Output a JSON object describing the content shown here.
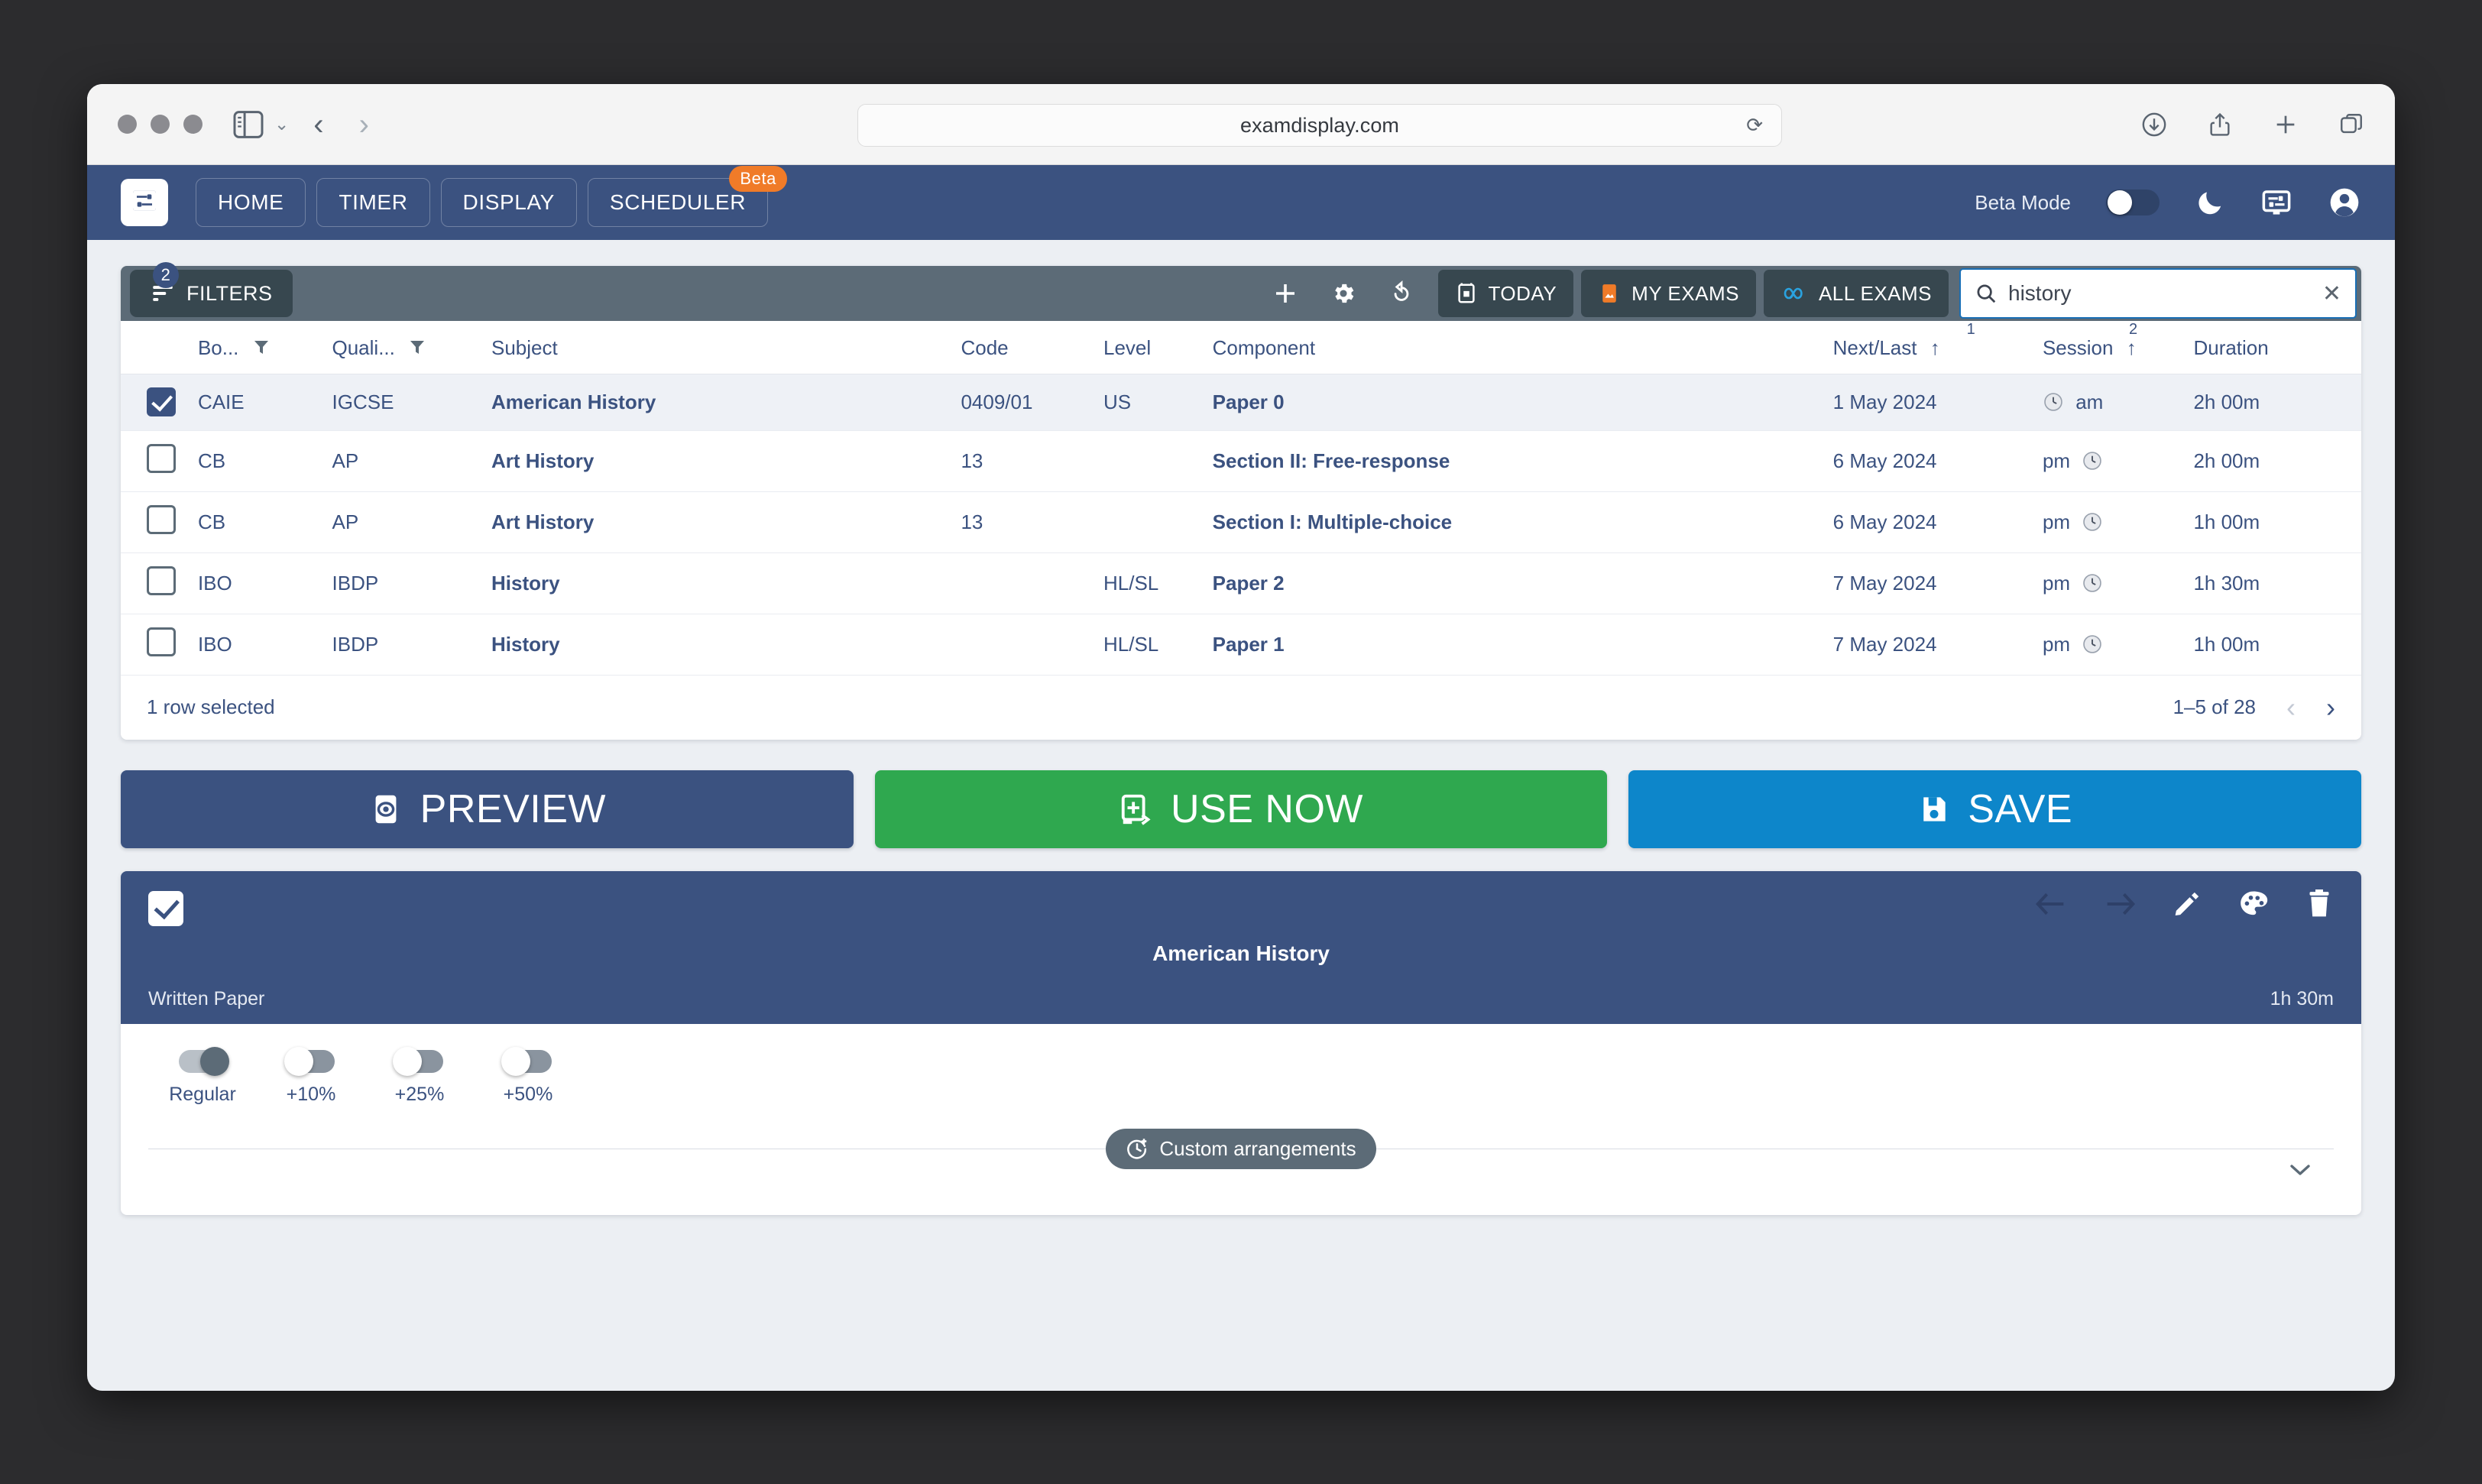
{
  "browser": {
    "url": "examdisplay.com",
    "icons": [
      "sidebar-icon",
      "chevron-down-icon",
      "back-arrow-icon",
      "forward-arrow-icon",
      "reload-icon",
      "downloads-icon",
      "share-icon",
      "new-tab-icon",
      "tab-overview-icon"
    ]
  },
  "app_nav": {
    "brand": "exam-display-logo",
    "tabs": [
      {
        "label": "HOME",
        "badge": ""
      },
      {
        "label": "TIMER",
        "badge": ""
      },
      {
        "label": "DISPLAY",
        "badge": ""
      },
      {
        "label": "SCHEDULER",
        "badge": "Beta"
      }
    ],
    "beta_mode_label": "Beta Mode",
    "beta_mode_on": true,
    "right_icons": [
      "moon-icon",
      "display-settings-icon",
      "account-icon"
    ]
  },
  "toolbar": {
    "filters_label": "FILTERS",
    "filters_count": "2",
    "add_label": "add-icon",
    "settings_label": "gear-icon",
    "reset_label": "undo-icon",
    "today_label": "TODAY",
    "my_exams_label": "MY EXAMS",
    "all_exams_label": "ALL EXAMS",
    "search_value": "history",
    "search_placeholder": "Search"
  },
  "table": {
    "headers": {
      "board": "Bo...",
      "qualification": "Quali...",
      "subject": "Subject",
      "code": "Code",
      "level": "Level",
      "component": "Component",
      "next_last": "Next/Last",
      "next_last_sort": "1",
      "session": "Session",
      "session_sort": "2",
      "duration": "Duration"
    },
    "rows": [
      {
        "selected": true,
        "board": "CAIE",
        "qualification": "IGCSE",
        "subject": "American History",
        "code": "0409/01",
        "level": "US",
        "component": "Paper 0",
        "next_last": "1 May 2024",
        "session": "am",
        "session_icon_side": "left",
        "duration": "2h 00m"
      },
      {
        "selected": false,
        "board": "CB",
        "qualification": "AP",
        "subject": "Art History",
        "code": "13",
        "level": "",
        "component": "Section II: Free-response",
        "next_last": "6 May 2024",
        "session": "pm",
        "session_icon_side": "right",
        "duration": "2h 00m"
      },
      {
        "selected": false,
        "board": "CB",
        "qualification": "AP",
        "subject": "Art History",
        "code": "13",
        "level": "",
        "component": "Section I: Multiple-choice",
        "next_last": "6 May 2024",
        "session": "pm",
        "session_icon_side": "right",
        "duration": "1h 00m"
      },
      {
        "selected": false,
        "board": "IBO",
        "qualification": "IBDP",
        "subject": "History",
        "code": "",
        "level": "HL/SL",
        "component": "Paper 2",
        "next_last": "7 May 2024",
        "session": "pm",
        "session_icon_side": "right",
        "duration": "1h 30m"
      },
      {
        "selected": false,
        "board": "IBO",
        "qualification": "IBDP",
        "subject": "History",
        "code": "",
        "level": "HL/SL",
        "component": "Paper 1",
        "next_last": "7 May 2024",
        "session": "pm",
        "session_icon_side": "right",
        "duration": "1h 00m"
      }
    ],
    "footer": {
      "selection": "1 row selected",
      "range": "1–5 of 28"
    }
  },
  "actions": {
    "preview": "PREVIEW",
    "use_now": "USE NOW",
    "save": "SAVE"
  },
  "detail": {
    "title": "American History",
    "type": "Written Paper",
    "duration": "1h 30m",
    "checked": true,
    "icons": [
      "arrow-left-icon",
      "arrow-right-icon",
      "pencil-icon",
      "palette-icon",
      "trash-icon"
    ],
    "toggles": [
      {
        "label": "Regular",
        "on": true
      },
      {
        "label": "+10%",
        "on": false
      },
      {
        "label": "+25%",
        "on": false
      },
      {
        "label": "+50%",
        "on": false
      }
    ],
    "custom_chip": "Custom arrangements"
  },
  "colors": {
    "nav_blue": "#3b5280",
    "toolbar_slate": "#5c6b77",
    "chip_dark": "#37474f",
    "green": "#2fa84f",
    "blue": "#0d86ca",
    "orange": "#f07b28"
  }
}
